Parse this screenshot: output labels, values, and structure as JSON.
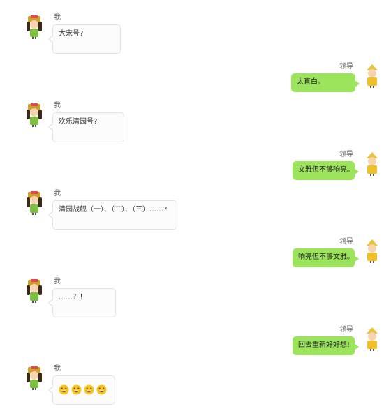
{
  "conversation": [
    {
      "side": "left",
      "sender": "我",
      "text": "大宋号?"
    },
    {
      "side": "right",
      "sender": "领导",
      "text": "太直白。"
    },
    {
      "side": "left",
      "sender": "我",
      "text": "欢乐清园号?"
    },
    {
      "side": "right",
      "sender": "领导",
      "text": "文雅但不够响亮。"
    },
    {
      "side": "left",
      "sender": "我",
      "text": "清园战舰（一）、（二）、（三）……?"
    },
    {
      "side": "right",
      "sender": "领导",
      "text": "响亮但不够文雅。"
    },
    {
      "side": "left",
      "sender": "我",
      "text": "……？！"
    },
    {
      "side": "right",
      "sender": "领导",
      "text": "回去重新好好想!"
    },
    {
      "side": "left",
      "sender": "我",
      "text": "",
      "emojis": [
        "grinning-face-icon",
        "grinning-face-icon",
        "grinning-face-icon",
        "grinning-face-icon"
      ]
    }
  ],
  "colors": {
    "right_bubble": "#9be45c",
    "left_bubble": "#fcfcfc",
    "left_border": "#e3e3e3"
  }
}
